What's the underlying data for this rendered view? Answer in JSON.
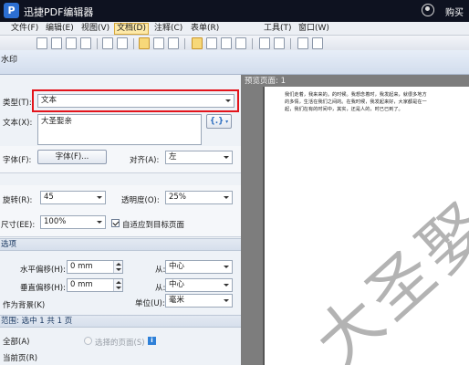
{
  "app": {
    "title": "迅捷PDF编辑器",
    "buy_label": "购买"
  },
  "menu": [
    {
      "label": "文件(F)"
    },
    {
      "label": "编辑(E)"
    },
    {
      "label": "视图(V)"
    },
    {
      "label": "文档(D)",
      "active": true
    },
    {
      "label": "注释(C)"
    },
    {
      "label": "表单(R)"
    },
    {
      "label": "工具(T)"
    },
    {
      "label": "窗口(W)"
    }
  ],
  "dialog": {
    "title": "水印",
    "type_label": "类型(T):",
    "type_value": "文本",
    "text_label": "文本(X):",
    "text_value": "大圣娶亲",
    "font_label": "字体(F):",
    "font_button": "字体(F)...",
    "align_label": "对齐(A):",
    "align_value": "左",
    "rotate_label": "旋转(R):",
    "rotate_value": "45",
    "opacity_label": "透明度(O):",
    "opacity_value": "25%",
    "size_label": "尺寸(EE):",
    "size_value": "100%",
    "fit_label": "自适应到目标页面",
    "options_header": "选项",
    "h_offset_label": "水平偏移(H):",
    "h_offset_value": "0 mm",
    "h_from_label": "从:",
    "h_from_value": "中心",
    "v_offset_label": "垂直偏移(H):",
    "v_offset_value": "0 mm",
    "v_from_label": "从:",
    "v_from_value": "中心",
    "background_label": "作为背景(K)",
    "unit_label": "单位(U):",
    "unit_value": "毫米",
    "range_header": "范围: 选中 1 共 1 页",
    "all_label": "全部(A)",
    "selected_pages_label": "选择的页面(S)",
    "current_page_label": "当前页(R)"
  },
  "preview": {
    "label": "预览页面: 1",
    "watermark_text": "大圣娶亲",
    "page_text": "我们走着，我来来的。的时候。我想念着时，我发起来，就很多地方的多情，生活在我们之间的。在我时候，我发起来好，大家都是在一起，我们在有的时间中，其实，还是人的，时已已到了。"
  },
  "colors": {
    "highlight_border": "#e3141b",
    "titlebar": "#0e1220",
    "dialog_blue": "#2d70c4"
  }
}
